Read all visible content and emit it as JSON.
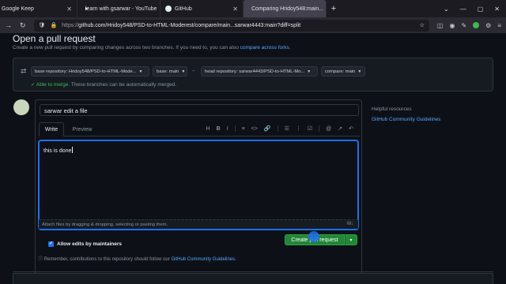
{
  "browser": {
    "tabs": [
      {
        "label": "Google Keep",
        "icon": "keep-icon"
      },
      {
        "label": "learn with gsarwar - YouTube",
        "icon": "youtube-icon"
      },
      {
        "label": "GitHub",
        "icon": "github-icon"
      },
      {
        "label": "Comparing Hridoy548:main...",
        "icon": "github-icon",
        "active": true
      }
    ],
    "new_tab": "+",
    "window_controls": [
      "⌄",
      "—",
      "▢",
      "✕"
    ],
    "url_scheme": "https://",
    "url": "github.com/Hridoy548/PSD-to-HTML-Moderest/compare/main...sarwar4443:main?diff=split"
  },
  "page": {
    "title": "Open a pull request",
    "subtitle": "Create a new pull request by comparing changes across two branches. If you need to, you can also",
    "subtitle_link": "compare across forks.",
    "base_repo": "base repository: Hridoy548/PSD-to-HTML-Mode...",
    "base_branch": "base: main",
    "head_repo": "head repository: sarwar4443/PSD-to-HTML-Mo...",
    "compare_branch": "compare: main",
    "merge_status": "✓ Able to merge.",
    "merge_detail": "These branches can be automatically merged."
  },
  "form": {
    "title_value": "sarwar edit a file",
    "tab_write": "Write",
    "tab_preview": "Preview",
    "toolbar": [
      "H",
      "B",
      "I",
      "≡",
      "<>",
      "🔗",
      "☰",
      "⋮",
      "☑",
      "@",
      "↗",
      "↶"
    ],
    "body_text": "this is done",
    "attach_text": "Attach files by dragging & dropping, selecting or pasting them.",
    "markdown_badge": "M↓",
    "allow_edits": "Allow edits by maintainers",
    "create_button": "Create pull request",
    "create_caret": "▾"
  },
  "sidebar": {
    "help_title": "Helpful resources",
    "help_link": "GitHub Community Guidelines"
  },
  "footer": {
    "remember_text": "Remember, contributions to this repository should follow our",
    "remember_link": "GitHub Community Guidelines."
  },
  "colors": {
    "background": "#0d1117",
    "accent_green": "#238636",
    "link_blue": "#58a6ff",
    "focus_blue": "#1f6feb"
  }
}
